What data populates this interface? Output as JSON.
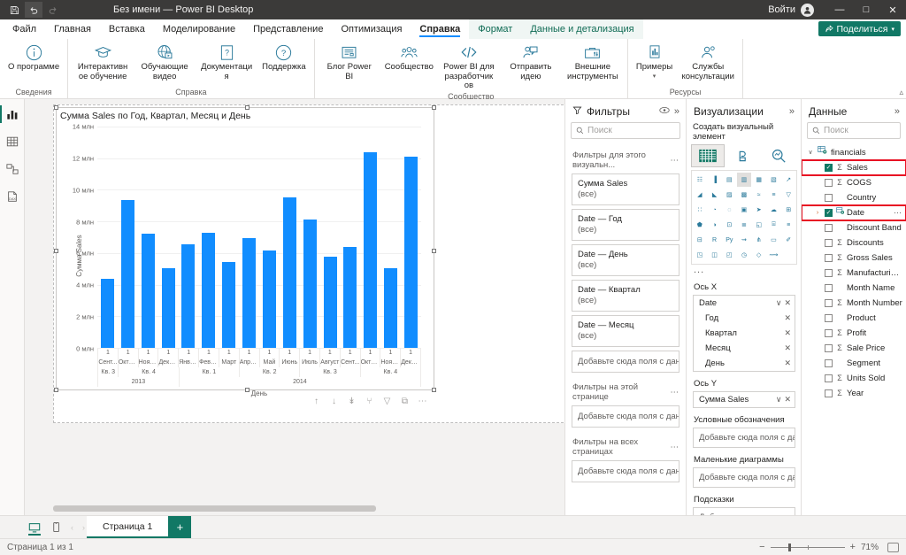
{
  "titlebar": {
    "save_icon": "save-icon",
    "undo_icon": "undo-icon",
    "redo_icon": "redo-icon",
    "title": "Без имени — Power BI Desktop",
    "signin_label": "Войти",
    "minimize": "—",
    "maximize": "□",
    "close": "✕"
  },
  "menu": {
    "tabs": [
      {
        "label": "Файл",
        "active": false,
        "contextual": false
      },
      {
        "label": "Главная",
        "active": false,
        "contextual": false
      },
      {
        "label": "Вставка",
        "active": false,
        "contextual": false
      },
      {
        "label": "Моделирование",
        "active": false,
        "contextual": false
      },
      {
        "label": "Представление",
        "active": false,
        "contextual": false
      },
      {
        "label": "Оптимизация",
        "active": false,
        "contextual": false
      },
      {
        "label": "Справка",
        "active": true,
        "contextual": false
      }
    ],
    "contextual_tabs": [
      {
        "label": "Формат"
      },
      {
        "label": "Данные и детализация"
      }
    ],
    "share_label": "Поделиться"
  },
  "ribbon": {
    "groups": [
      {
        "name": "Сведения",
        "items": [
          {
            "label": "О программе",
            "icon": "info-icon"
          }
        ]
      },
      {
        "name": "Справка",
        "items": [
          {
            "label": "Интерактивное обучение",
            "icon": "graduation-cap-icon"
          },
          {
            "label": "Обучающие видео",
            "icon": "globe-video-icon"
          },
          {
            "label": "Документация",
            "icon": "document-question-icon"
          },
          {
            "label": "Поддержка",
            "icon": "question-circle-icon"
          }
        ]
      },
      {
        "name": "Сообщество",
        "items": [
          {
            "label": "Блог Power BI",
            "icon": "blog-icon"
          },
          {
            "label": "Сообщество",
            "icon": "people-icon"
          },
          {
            "label": "Power BI для разработчиков",
            "icon": "code-icon"
          },
          {
            "label": "Отправить идею",
            "icon": "feedback-icon"
          },
          {
            "label": "Внешние инструменты",
            "icon": "toolbox-icon"
          }
        ]
      },
      {
        "name": "Ресурсы",
        "items": [
          {
            "label": "Примеры",
            "icon": "samples-icon",
            "has_chevron": true
          },
          {
            "label": "Службы консультации",
            "icon": "consulting-icon"
          }
        ]
      }
    ]
  },
  "rail": {
    "items": [
      {
        "name": "report-view",
        "icon": "bar-chart-icon",
        "active": true
      },
      {
        "name": "table-view",
        "icon": "table-icon",
        "active": false
      },
      {
        "name": "model-view",
        "icon": "model-icon",
        "active": false
      },
      {
        "name": "dax-query-view",
        "icon": "dax-query-icon",
        "active": false
      }
    ]
  },
  "chart_data": {
    "type": "bar",
    "title": "Сумма Sales по Год, Квартал, Месяц и День",
    "xlabel": "День",
    "ylabel": "Сумма Sales",
    "ylim": [
      0,
      14000000
    ],
    "ytick_labels": [
      "0 млн",
      "2 млн",
      "4 млн",
      "6 млн",
      "8 млн",
      "10 млн",
      "12 млн",
      "14 млн"
    ],
    "ytick_values": [
      0,
      2000000,
      4000000,
      6000000,
      8000000,
      10000000,
      12000000,
      14000000
    ],
    "grid": true,
    "legend": "none",
    "bar_color": "#118dff",
    "categories": [
      "Сент...",
      "Октяб...",
      "Ноябрь",
      "Декаб...",
      "Январь",
      "Февр...",
      "Март",
      "Апрель",
      "Май",
      "Июнь",
      "Июль",
      "Август",
      "Сент...",
      "Октяб...",
      "Ноябрь",
      "Декаб..."
    ],
    "day_labels": [
      "1",
      "1",
      "1",
      "1",
      "1",
      "1",
      "1",
      "1",
      "1",
      "1",
      "1",
      "1",
      "1",
      "1",
      "1",
      "1"
    ],
    "values": [
      4350000,
      9350000,
      7200000,
      5050000,
      6580000,
      7290000,
      5420000,
      6920000,
      6170000,
      9530000,
      8140000,
      5770000,
      6380000,
      12400000,
      5050000,
      12070000
    ],
    "quarter_groups": [
      {
        "label": "Кв. 3",
        "span": 1
      },
      {
        "label": "Кв. 4",
        "span": 3
      },
      {
        "label": "Кв. 1",
        "span": 3
      },
      {
        "label": "Кв. 2",
        "span": 3
      },
      {
        "label": "Кв. 3",
        "span": 3
      },
      {
        "label": "Кв. 4",
        "span": 3
      }
    ],
    "year_groups": [
      {
        "label": "2013",
        "span": 4
      },
      {
        "label": "2014",
        "span": 12
      }
    ]
  },
  "visual_toolbar": {
    "buttons": [
      {
        "name": "drill-up-icon",
        "glyph": "↑"
      },
      {
        "name": "drill-down-icon",
        "glyph": "↓"
      },
      {
        "name": "expand-all-icon",
        "glyph": "↡"
      },
      {
        "name": "drill-hierarchy-icon",
        "glyph": "⑂"
      },
      {
        "name": "filter-icon",
        "glyph": "▽"
      },
      {
        "name": "focus-mode-icon",
        "glyph": "⧉"
      },
      {
        "name": "more-options-icon",
        "glyph": "⋯"
      }
    ]
  },
  "filters_pane": {
    "title": "Фильтры",
    "eye_icon": "eye-icon",
    "expand_icon": "chevron-double-right-icon",
    "search_placeholder": "Поиск",
    "sections": [
      {
        "label": "Фильтры для этого визуальн...",
        "cards": [
          {
            "name": "Сумма Sales",
            "value": "(все)"
          },
          {
            "name": "Date — Год",
            "value": "(все)"
          },
          {
            "name": "Date — День",
            "value": "(все)"
          },
          {
            "name": "Date — Квартал",
            "value": "(все)"
          },
          {
            "name": "Date — Месяц",
            "value": "(все)"
          }
        ],
        "dropzone": "Добавьте сюда поля с дан..."
      },
      {
        "label": "Фильтры на этой странице",
        "cards": [],
        "dropzone": "Добавьте сюда поля с дан..."
      },
      {
        "label": "Фильтры на всех страницах",
        "cards": [],
        "dropzone": "Добавьте сюда поля с дан..."
      }
    ]
  },
  "visualizations_pane": {
    "title": "Визуализации",
    "expand_icon": "chevron-double-right-icon",
    "subtitle": "Создать визуальный элемент",
    "type_buttons": [
      {
        "name": "build-visual-icon",
        "selected": true
      },
      {
        "name": "format-visual-icon",
        "selected": false
      },
      {
        "name": "analytics-icon",
        "selected": false
      }
    ],
    "gallery": [
      "stacked-bar-chart",
      "stacked-column-chart",
      "clustered-bar-chart",
      "clustered-column-chart",
      "100-stacked-bar-chart",
      "100-stacked-column-chart",
      "line-chart",
      "area-chart",
      "stacked-area-chart",
      "line-stacked-column-chart",
      "line-clustered-column-chart",
      "ribbon-chart",
      "waterfall-chart",
      "funnel-chart",
      "scatter-chart",
      "pie-chart",
      "donut-chart",
      "treemap",
      "map",
      "filled-map",
      "shape-map",
      "azure-map",
      "gauge-chart",
      "card",
      "multi-row-card",
      "kpi",
      "slicer",
      "table",
      "matrix",
      "r-script-visual",
      "python-visual",
      "key-influencers",
      "decomposition-tree",
      "qa-visual",
      "smart-narrative",
      "metrics-visual",
      "paginated-report",
      "power-apps-visual",
      "power-automate-visual",
      "get-more-visuals",
      "more-options-visual"
    ],
    "gallery_selected_index": 3,
    "more_glyph": "...",
    "wells": [
      {
        "label": "Ось X",
        "type": "hierarchy",
        "items": [
          {
            "name": "Date",
            "level": 0,
            "has_chevron": true,
            "has_remove": true
          },
          {
            "name": "Год",
            "level": 1,
            "has_chevron": false,
            "has_remove": true
          },
          {
            "name": "Квартал",
            "level": 1,
            "has_chevron": false,
            "has_remove": true
          },
          {
            "name": "Месяц",
            "level": 1,
            "has_chevron": false,
            "has_remove": true
          },
          {
            "name": "День",
            "level": 1,
            "has_chevron": false,
            "has_remove": true
          }
        ]
      },
      {
        "label": "Ось Y",
        "type": "fields",
        "items": [
          {
            "name": "Сумма Sales",
            "level": 0,
            "has_chevron": true,
            "has_remove": true
          }
        ]
      },
      {
        "label": "Условные обозначения",
        "type": "empty",
        "placeholder": "Добавьте сюда поля с дан..."
      },
      {
        "label": "Маленькие диаграммы",
        "type": "empty",
        "placeholder": "Добавьте сюда поля с дан..."
      },
      {
        "label": "Подсказки",
        "type": "empty",
        "placeholder": "Добавьте сюда поля с дан..."
      }
    ]
  },
  "data_pane": {
    "title": "Данные",
    "expand_icon": "chevron-double-right-icon",
    "search_placeholder": "Поиск",
    "table": {
      "name": "financials",
      "expanded": true,
      "icon": "table-linked-icon"
    },
    "fields": [
      {
        "name": "Sales",
        "checked": true,
        "measure": true,
        "highlighted": true,
        "chevron": ""
      },
      {
        "name": "COGS",
        "checked": false,
        "measure": true,
        "highlighted": false,
        "chevron": ""
      },
      {
        "name": "Country",
        "checked": false,
        "measure": false,
        "highlighted": false,
        "chevron": ""
      },
      {
        "name": "Date",
        "checked": true,
        "measure": false,
        "highlighted": true,
        "chevron": "›",
        "date_hierarchy": true,
        "more": "⋯"
      },
      {
        "name": "Discount Band",
        "checked": false,
        "measure": false,
        "highlighted": false,
        "chevron": ""
      },
      {
        "name": "Discounts",
        "checked": false,
        "measure": true,
        "highlighted": false,
        "chevron": ""
      },
      {
        "name": "Gross Sales",
        "checked": false,
        "measure": true,
        "highlighted": false,
        "chevron": ""
      },
      {
        "name": "Manufacturing ...",
        "checked": false,
        "measure": true,
        "highlighted": false,
        "chevron": ""
      },
      {
        "name": "Month Name",
        "checked": false,
        "measure": false,
        "highlighted": false,
        "chevron": ""
      },
      {
        "name": "Month Number",
        "checked": false,
        "measure": true,
        "highlighted": false,
        "chevron": ""
      },
      {
        "name": "Product",
        "checked": false,
        "measure": false,
        "highlighted": false,
        "chevron": ""
      },
      {
        "name": "Profit",
        "checked": false,
        "measure": true,
        "highlighted": false,
        "chevron": ""
      },
      {
        "name": "Sale Price",
        "checked": false,
        "measure": true,
        "highlighted": false,
        "chevron": ""
      },
      {
        "name": "Segment",
        "checked": false,
        "measure": false,
        "highlighted": false,
        "chevron": ""
      },
      {
        "name": "Units Sold",
        "checked": false,
        "measure": true,
        "highlighted": false,
        "chevron": ""
      },
      {
        "name": "Year",
        "checked": false,
        "measure": true,
        "highlighted": false,
        "chevron": ""
      }
    ]
  },
  "footer": {
    "desktop_view_icon": "desktop-layout-icon",
    "mobile_view_icon": "mobile-layout-icon",
    "prev_glyph": "‹",
    "next_glyph": "›",
    "page_tab": "Страница 1",
    "add_page_glyph": "+",
    "status_text": "Страница 1 из 1",
    "zoom_minus": "−",
    "zoom_plus": "+",
    "zoom_percent": "71%",
    "fit_icon": "fit-to-page-icon"
  }
}
